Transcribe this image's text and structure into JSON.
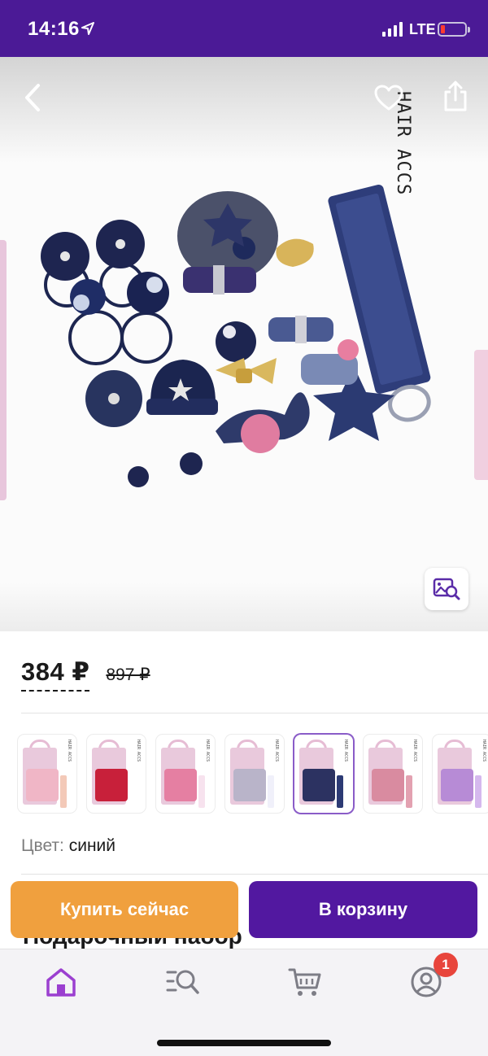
{
  "status_bar": {
    "time": "14:16",
    "network": "LTE",
    "battery_color": "#ff3b30"
  },
  "gallery": {
    "image_text": "HAIR ACCS",
    "back_icon": "chevron-left-icon",
    "favorite_icon": "heart-icon",
    "share_icon": "share-icon",
    "visual_search_icon": "image-search-icon"
  },
  "price": {
    "current": "384 ₽",
    "old": "897 ₽"
  },
  "variants": [
    {
      "set_color": "#f0b6c6",
      "strap_color": "#f3c9b8"
    },
    {
      "set_color": "#c8203a",
      "strap_color": "#ffffff"
    },
    {
      "set_color": "#e57fa2",
      "strap_color": "#f7e2ee"
    },
    {
      "set_color": "#b9b4c9",
      "strap_color": "#f0f0fa"
    },
    {
      "set_color": "#2c3261",
      "strap_color": "#2c3a74",
      "selected": true
    },
    {
      "set_color": "#d98ba0",
      "strap_color": "#e3a1b1"
    },
    {
      "set_color": "#b78bd6",
      "strap_color": "#d5b8ee"
    }
  ],
  "variant_label": "HAIR ACCS",
  "color": {
    "label": "Цвет:",
    "value": "синий"
  },
  "product_title": "Подарочный набор",
  "actions": {
    "buy_now": "Купить сейчас",
    "add_to_cart": "В корзину"
  },
  "tabs": [
    {
      "name": "home",
      "icon": "home-icon",
      "active": true
    },
    {
      "name": "catalog",
      "icon": "catalog-search-icon"
    },
    {
      "name": "cart",
      "icon": "cart-icon"
    },
    {
      "name": "profile",
      "icon": "profile-icon"
    }
  ],
  "cart_badge": "1",
  "colors": {
    "brand": "#4b1a96",
    "accent_orange": "#f0a03e",
    "button_purple": "#5218a0",
    "active_tab": "#9b3fd0"
  }
}
